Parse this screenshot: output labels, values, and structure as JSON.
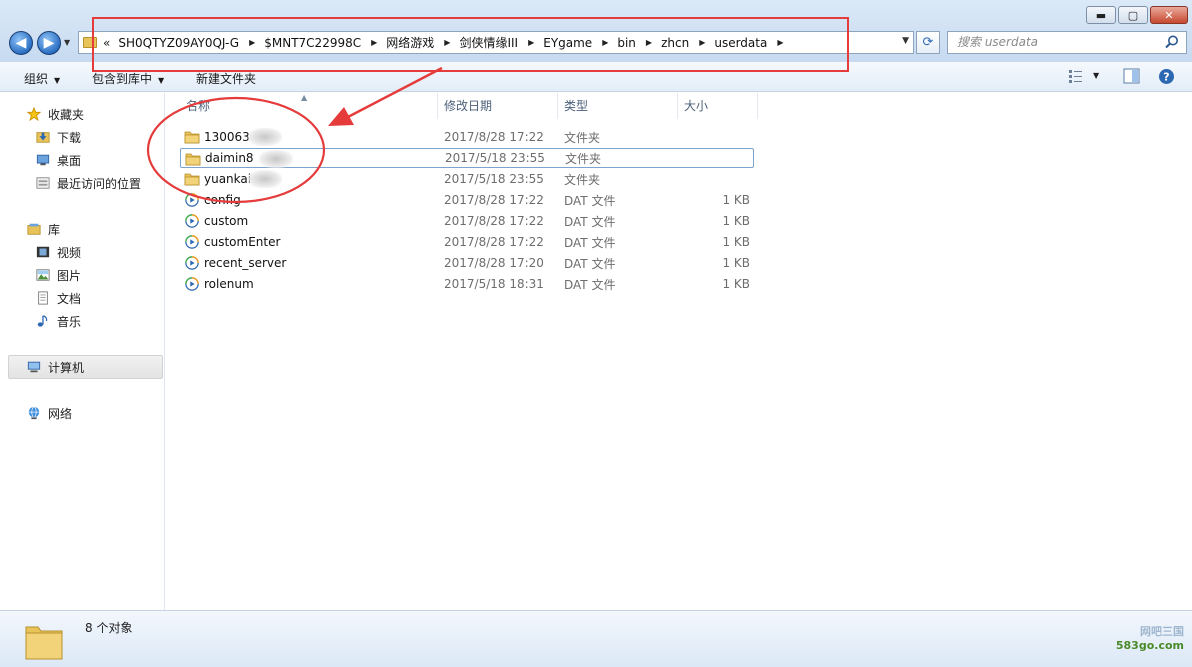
{
  "window": {
    "minimize_label": "▬",
    "maximize_label": "▢",
    "close_label": "✕"
  },
  "address": {
    "overflow": "«",
    "crumbs": [
      "SH0QTYZ09AY0QJ-G",
      "$MNT7C22998C",
      "网络游戏",
      "剑侠情缘III",
      "EYgame",
      "bin",
      "zhcn",
      "userdata"
    ]
  },
  "search": {
    "placeholder": "搜索 userdata"
  },
  "toolbar": {
    "organize": "组织",
    "include_in_library": "包含到库中",
    "new_folder": "新建文件夹"
  },
  "sidebar": {
    "favorites": "收藏夹",
    "downloads": "下载",
    "desktop": "桌面",
    "recent": "最近访问的位置",
    "libraries": "库",
    "videos": "视频",
    "pictures": "图片",
    "documents": "文档",
    "music": "音乐",
    "computer": "计算机",
    "network": "网络"
  },
  "columns": {
    "name": "名称",
    "date": "修改日期",
    "type": "类型",
    "size": "大小"
  },
  "files": [
    {
      "name": "130063",
      "date": "2017/8/28 17:22",
      "type": "文件夹",
      "size": "",
      "kind": "folder"
    },
    {
      "name": "daimin8",
      "date": "2017/5/18 23:55",
      "type": "文件夹",
      "size": "",
      "kind": "folder"
    },
    {
      "name": "yuankai",
      "date": "2017/5/18 23:55",
      "type": "文件夹",
      "size": "",
      "kind": "folder"
    },
    {
      "name": "config",
      "date": "2017/8/28 17:22",
      "type": "DAT 文件",
      "size": "1 KB",
      "kind": "dat"
    },
    {
      "name": "custom",
      "date": "2017/8/28 17:22",
      "type": "DAT 文件",
      "size": "1 KB",
      "kind": "dat"
    },
    {
      "name": "customEnter",
      "date": "2017/8/28 17:22",
      "type": "DAT 文件",
      "size": "1 KB",
      "kind": "dat"
    },
    {
      "name": "recent_server",
      "date": "2017/8/28 17:20",
      "type": "DAT 文件",
      "size": "1 KB",
      "kind": "dat"
    },
    {
      "name": "rolenum",
      "date": "2017/5/18 18:31",
      "type": "DAT 文件",
      "size": "1 KB",
      "kind": "dat"
    }
  ],
  "status": {
    "count": "8 个对象"
  },
  "watermark": {
    "line1": "网吧三国",
    "line2": "583go.com"
  },
  "colors": {
    "annotation_red": "#e53b3b",
    "folder_yellow": "#e8c35a",
    "accent_blue": "#2b6fc3"
  }
}
